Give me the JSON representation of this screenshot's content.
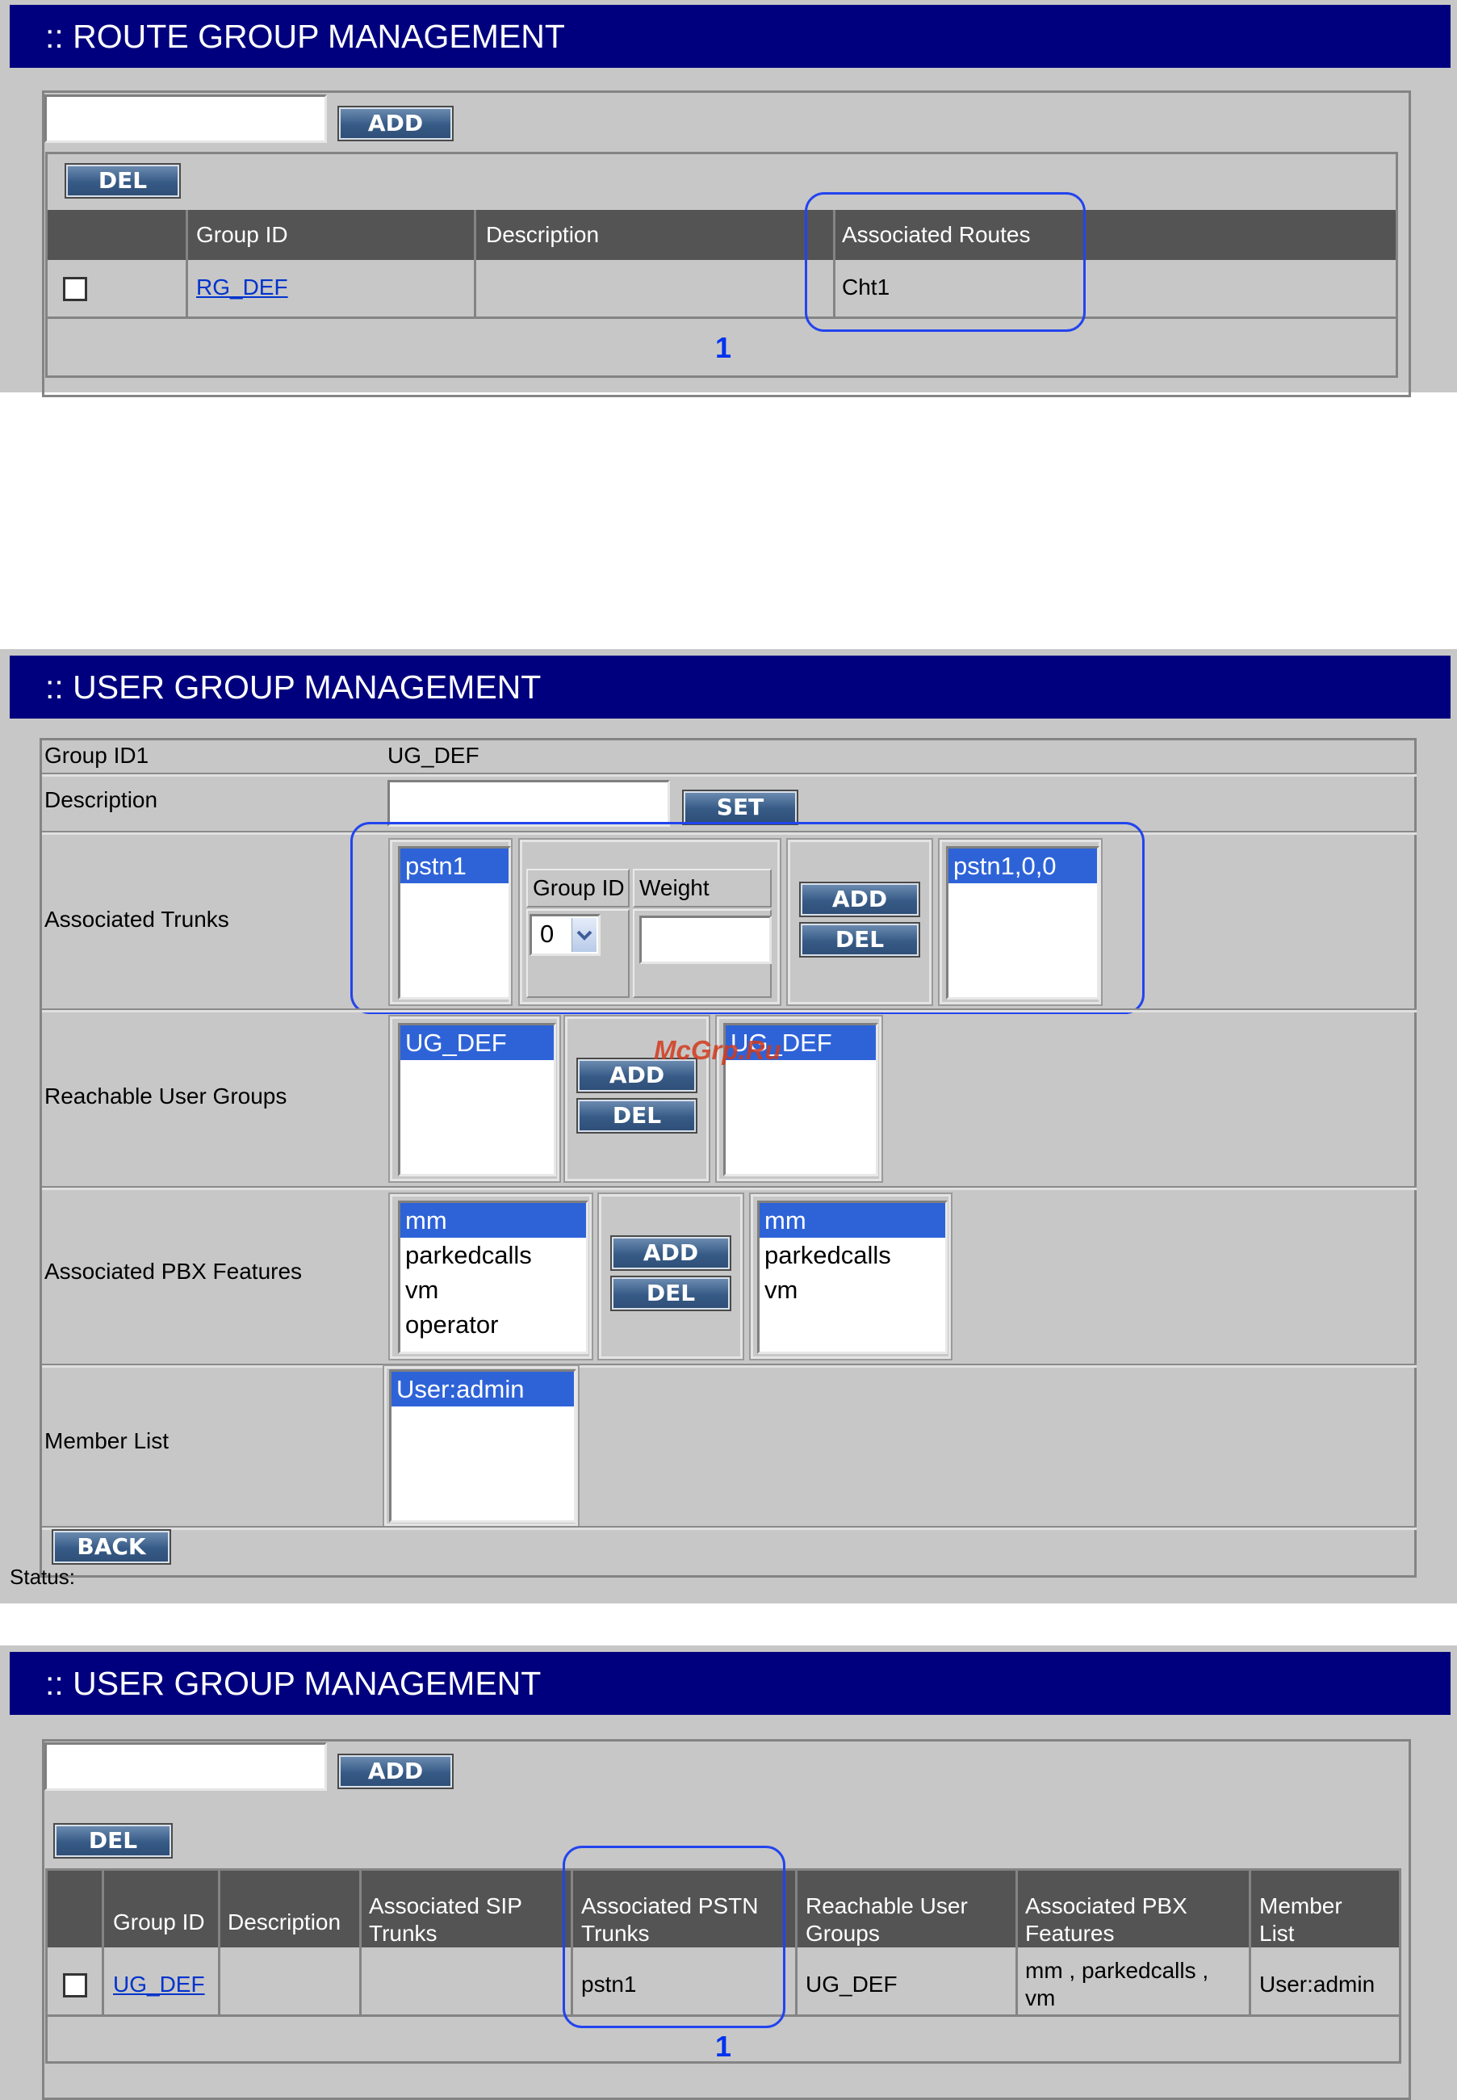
{
  "route_group": {
    "title": ":: ROUTE GROUP MANAGEMENT",
    "add_input_value": "",
    "add_label": "ADD",
    "del_label": "DEL",
    "columns": [
      "Group ID",
      "Description",
      "Associated Routes"
    ],
    "row": {
      "group_id": "RG_DEF",
      "description": "",
      "associated_routes": "Cht1"
    },
    "page": "1"
  },
  "user_group_edit": {
    "title": ":: USER GROUP MANAGEMENT",
    "group_id_label": "Group ID1",
    "group_id_value": "UG_DEF",
    "description_label": "Description",
    "description_value": "",
    "set_label": "SET",
    "trunks": {
      "label": "Associated Trunks",
      "available": [
        "pstn1"
      ],
      "group_id_header": "Group ID",
      "weight_header": "Weight",
      "group_id_select": "0",
      "weight_value": "",
      "add_label": "ADD",
      "del_label": "DEL",
      "selected": [
        "pstn1,0,0"
      ]
    },
    "reachable": {
      "label": "Reachable User Groups",
      "available": [
        "UG_DEF"
      ],
      "add_label": "ADD",
      "del_label": "DEL",
      "selected": [
        "UG_DEF"
      ]
    },
    "pbx": {
      "label": "Associated PBX Features",
      "available": [
        "mm",
        "parkedcalls",
        "vm",
        "operator"
      ],
      "add_label": "ADD",
      "del_label": "DEL",
      "selected": [
        "mm",
        "parkedcalls",
        "vm"
      ]
    },
    "members": {
      "label": "Member List",
      "items": [
        "User:admin"
      ]
    },
    "back_label": "BACK",
    "status_label": "Status:",
    "watermark": "McGrp.Ru"
  },
  "user_group_list": {
    "title": ":: USER GROUP MANAGEMENT",
    "add_input_value": "",
    "add_label": "ADD",
    "del_label": "DEL",
    "columns": {
      "group_id": "Group ID",
      "description": "Description",
      "sip_1": "Associated SIP",
      "sip_2": "Trunks",
      "pstn_1": "Associated PSTN",
      "pstn_2": "Trunks",
      "reach_1": "Reachable User",
      "reach_2": "Groups",
      "pbx_1": "Associated PBX",
      "pbx_2": "Features",
      "member_1": "Member",
      "member_2": "List"
    },
    "row": {
      "group_id": "UG_DEF",
      "description": "",
      "sip_trunks": "",
      "pstn_trunks": "pstn1",
      "reachable": "UG_DEF",
      "pbx_1": "mm , parkedcalls ,",
      "pbx_2": "vm",
      "members": "User:admin"
    },
    "page": "1"
  },
  "colors": {
    "title_bar": "#00007e",
    "highlight_outline": "#2244ee",
    "selected_option": "#2e63d8",
    "link": "#0033cc"
  }
}
